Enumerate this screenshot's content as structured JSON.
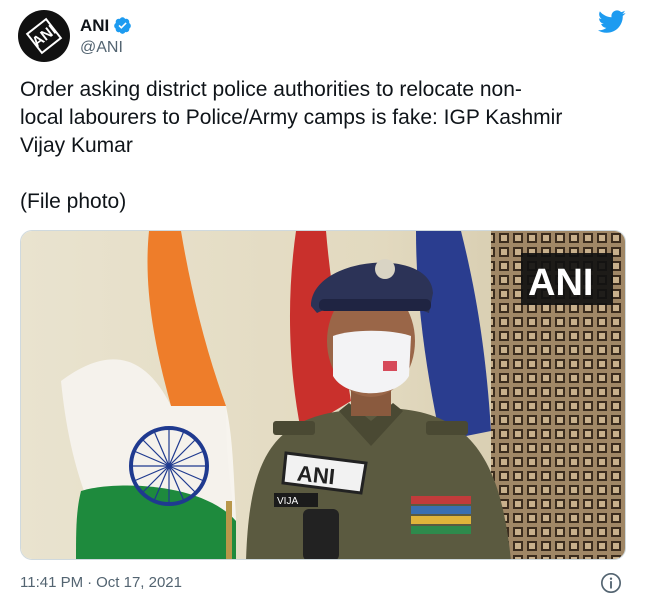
{
  "author": {
    "display_name": "ANI",
    "handle": "@ANI",
    "avatar_text": "ANI"
  },
  "tweet": {
    "text": "Order asking district police authorities to relocate non-\nlocal labourers to Police/Army camps is fake: IGP Kashmir\nVijay Kumar\n\n(File photo)",
    "time": "11:41 PM",
    "separator": "·",
    "date": "Oct 17, 2021"
  },
  "media": {
    "watermark": "ANI",
    "mic_text": "ANI",
    "nameplate": "VIJA"
  },
  "icons": {
    "verified": "verified-badge-icon",
    "brand": "twitter-bird-icon",
    "info": "info-icon"
  },
  "colors": {
    "twitter_blue": "#1d9bf0",
    "text": "#0f1419",
    "secondary": "#536471"
  }
}
